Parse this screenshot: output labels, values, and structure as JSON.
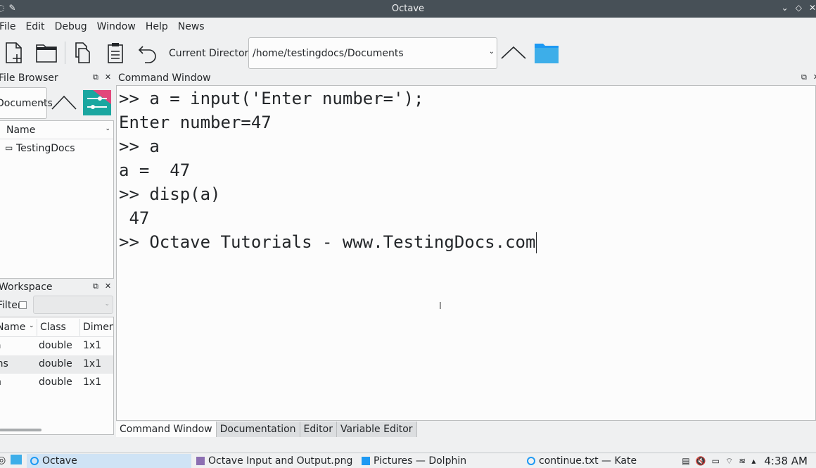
{
  "window": {
    "title": "Octave"
  },
  "menu": [
    "File",
    "Edit",
    "Debug",
    "Window",
    "Help",
    "News"
  ],
  "toolbar": {
    "current_dir_label": "Current Directory:",
    "current_dir_value": "/home/testingdocs/Documents"
  },
  "file_browser": {
    "title": "File Browser",
    "path_combo": "Documents",
    "column": "Name",
    "items": [
      "TestingDocs"
    ]
  },
  "workspace": {
    "title": "Workspace",
    "filter_label": "Filter",
    "columns": [
      "Name",
      "Class",
      "Dimension"
    ],
    "rows": [
      {
        "name": "a",
        "class": "double",
        "dim": "1x1"
      },
      {
        "name": "ans",
        "class": "double",
        "dim": "1x1"
      },
      {
        "name": "n",
        "class": "double",
        "dim": "1x1"
      }
    ]
  },
  "command_window": {
    "title": "Command Window",
    "lines": [
      ">> a = input('Enter number=');",
      "Enter number=47",
      ">> a",
      "a =  47",
      ">> disp(a)",
      " 47",
      ">> Octave Tutorials - www.TestingDocs.com"
    ]
  },
  "tabs": [
    "Command Window",
    "Documentation",
    "Editor",
    "Variable Editor"
  ],
  "taskbar": {
    "tasks": [
      "Octave",
      "Octave Input and Output.png —...",
      "Pictures — Dolphin",
      "continue.txt — Kate"
    ],
    "clock": "4:38 AM"
  },
  "colors": {
    "accent": "#3daee9",
    "titlebar": "#475057",
    "folder": "#1d99f3"
  }
}
